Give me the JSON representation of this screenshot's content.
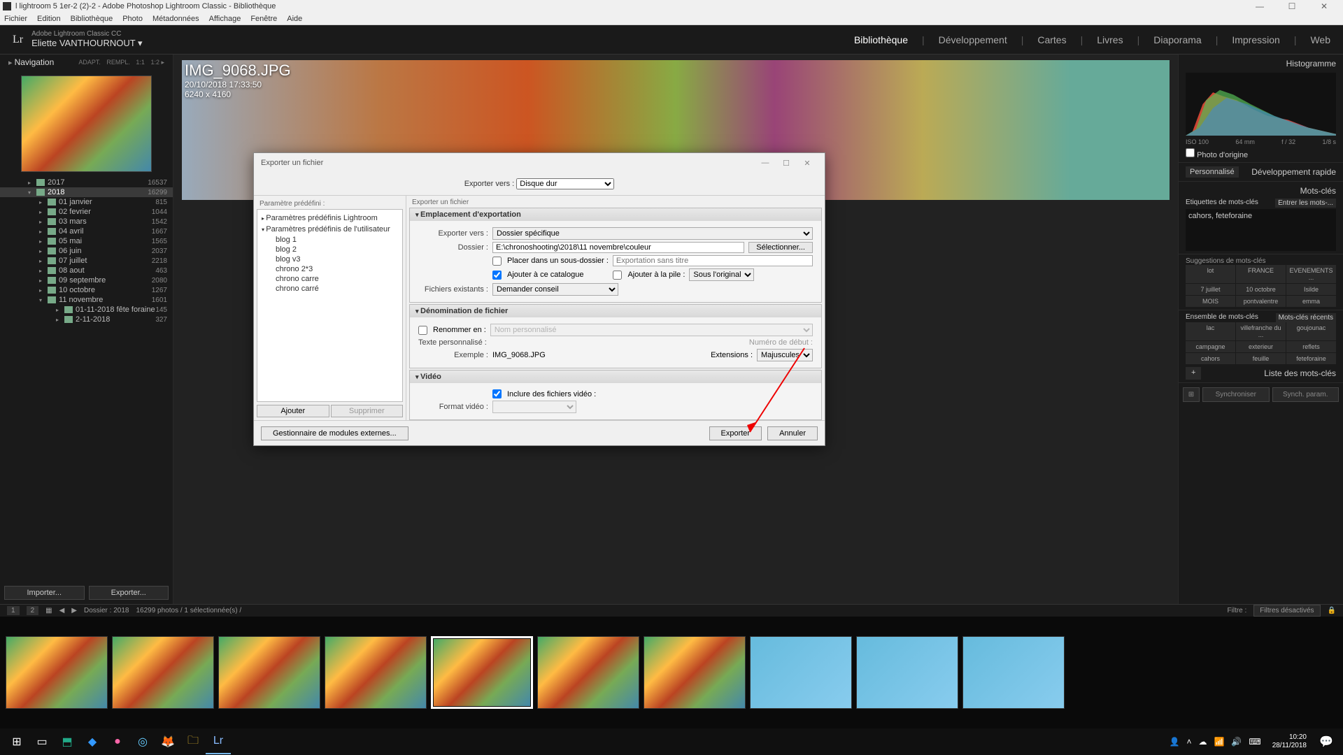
{
  "titlebar": {
    "text": "l lightroom 5 1er-2 (2)-2 - Adobe Photoshop Lightroom Classic - Bibliothèque"
  },
  "menubar": [
    "Fichier",
    "Edition",
    "Bibliothèque",
    "Photo",
    "Métadonnées",
    "Affichage",
    "Fenêtre",
    "Aide"
  ],
  "ident": {
    "product": "Adobe Lightroom Classic CC",
    "user": "Eliette VANTHOURNOUT ▾",
    "logo": "Lr"
  },
  "modules": [
    {
      "label": "Bibliothèque",
      "active": true
    },
    {
      "label": "Développement"
    },
    {
      "label": "Cartes"
    },
    {
      "label": "Livres"
    },
    {
      "label": "Diaporama"
    },
    {
      "label": "Impression"
    },
    {
      "label": "Web"
    }
  ],
  "left": {
    "nav_title": "Navigation",
    "zoom": [
      "ADAPT.",
      "REMPL.",
      "1:1",
      "1:2"
    ],
    "folders": [
      {
        "name": "2017",
        "count": "16537",
        "lvl": 0,
        "open": false
      },
      {
        "name": "2018",
        "count": "16299",
        "lvl": 0,
        "open": true,
        "sel": true
      },
      {
        "name": "01 janvier",
        "count": "815",
        "lvl": 1
      },
      {
        "name": "02 fevrier",
        "count": "1044",
        "lvl": 1
      },
      {
        "name": "03 mars",
        "count": "1542",
        "lvl": 1
      },
      {
        "name": "04 avril",
        "count": "1667",
        "lvl": 1
      },
      {
        "name": "05 mai",
        "count": "1565",
        "lvl": 1
      },
      {
        "name": "06 juin",
        "count": "2037",
        "lvl": 1
      },
      {
        "name": "07 juillet",
        "count": "2218",
        "lvl": 1
      },
      {
        "name": "08 aout",
        "count": "463",
        "lvl": 1
      },
      {
        "name": "09 septembre",
        "count": "2080",
        "lvl": 1
      },
      {
        "name": "10 octobre",
        "count": "1267",
        "lvl": 1
      },
      {
        "name": "11 novembre",
        "count": "1601",
        "lvl": 1,
        "open": true
      },
      {
        "name": "01-11-2018 fête foraine",
        "count": "145",
        "lvl": 2
      },
      {
        "name": "2-11-2018",
        "count": "327",
        "lvl": 2
      }
    ],
    "import_btn": "Importer...",
    "export_btn": "Exporter..."
  },
  "hero": {
    "filename": "IMG_9068.JPG",
    "datetime": "20/10/2018 17:33:50",
    "dims": "6240 x 4160"
  },
  "right": {
    "histogram": "Histogramme",
    "histo_info": {
      "iso": "ISO 100",
      "focal": "64 mm",
      "ap": "f / 32",
      "sp": "1/8 s"
    },
    "origin_cb": "Photo d'origine",
    "custom": "Personnalisé",
    "quickdev": "Développement rapide",
    "keywords": "Mots-clés",
    "keyword_tags": "Etiquettes de mots-clés",
    "enter_kw": "Entrer les mots-...",
    "kw_value": "cahors, feteforaine",
    "kw_suggest_title": "Suggestions de mots-clés",
    "kw_suggest": [
      "lot",
      "FRANCE",
      "EVENEMENTS ...",
      "7 juillet",
      "10 octobre",
      "Isilde",
      "MOIS",
      "pontvalentre",
      "emma"
    ],
    "kw_set_title": "Ensemble de mots-clés",
    "kw_recent": "Mots-clés récents",
    "kw_set": [
      "lac",
      "villefranche du ...",
      "goujounac",
      "campagne",
      "exterieur",
      "reflets",
      "cahors",
      "feuille",
      "feteforaine"
    ],
    "kw_list": "Liste des mots-clés",
    "sync": "Synchroniser",
    "sync_param": "Synch. param."
  },
  "filmstrip_bar": {
    "pages": [
      "1",
      "2"
    ],
    "path": "Dossier : 2018",
    "count": "16299 photos / 1 sélectionnée(s) /",
    "filter": "Filtre :",
    "filter_val": "Filtres désactivés"
  },
  "dialog": {
    "title": "Exporter un fichier",
    "export_to_label": "Exporter vers :",
    "export_to": "Disque dur",
    "preset_label": "Paramètre prédéfini :",
    "preset_groups": [
      {
        "name": "Paramètres prédéfinis Lightroom",
        "open": false
      },
      {
        "name": "Paramètres prédéfinis de l'utilisateur",
        "open": true,
        "items": [
          "blog 1",
          "blog 2",
          "blog v3",
          "chrono 2*3",
          "chrono carre",
          "chrono carré"
        ]
      }
    ],
    "add": "Ajouter",
    "remove": "Supprimer",
    "right_label": "Exporter un fichier",
    "sections": {
      "location": {
        "title": "Emplacement d'exportation",
        "export_to_label": "Exporter vers :",
        "export_to": "Dossier spécifique",
        "folder_label": "Dossier :",
        "folder": "E:\\chronoshooting\\2018\\11 novembre\\couleur",
        "select": "Sélectionner...",
        "subfolder_cb": "Placer dans un sous-dossier :",
        "subfolder_ph": "Exportation sans titre",
        "add_cat": "Ajouter à ce catalogue",
        "add_pile": "Ajouter à la pile :",
        "pile_opt": "Sous l'original",
        "existing_label": "Fichiers existants :",
        "existing": "Demander conseil"
      },
      "naming": {
        "title": "Dénomination de fichier",
        "rename_cb": "Renommer en :",
        "rename_opt": "Nom personnalisé",
        "custom_label": "Texte personnalisé :",
        "start_label": "Numéro de début :",
        "example_label": "Exemple :",
        "example": "IMG_9068.JPG",
        "ext_label": "Extensions :",
        "ext": "Majuscules"
      },
      "video": {
        "title": "Vidéo",
        "include": "Inclure des fichiers vidéo :",
        "format_label": "Format vidéo :"
      }
    },
    "plugins": "Gestionnaire de modules externes...",
    "export": "Exporter",
    "cancel": "Annuler"
  },
  "taskbar": {
    "time": "10:20",
    "date": "28/11/2018"
  }
}
